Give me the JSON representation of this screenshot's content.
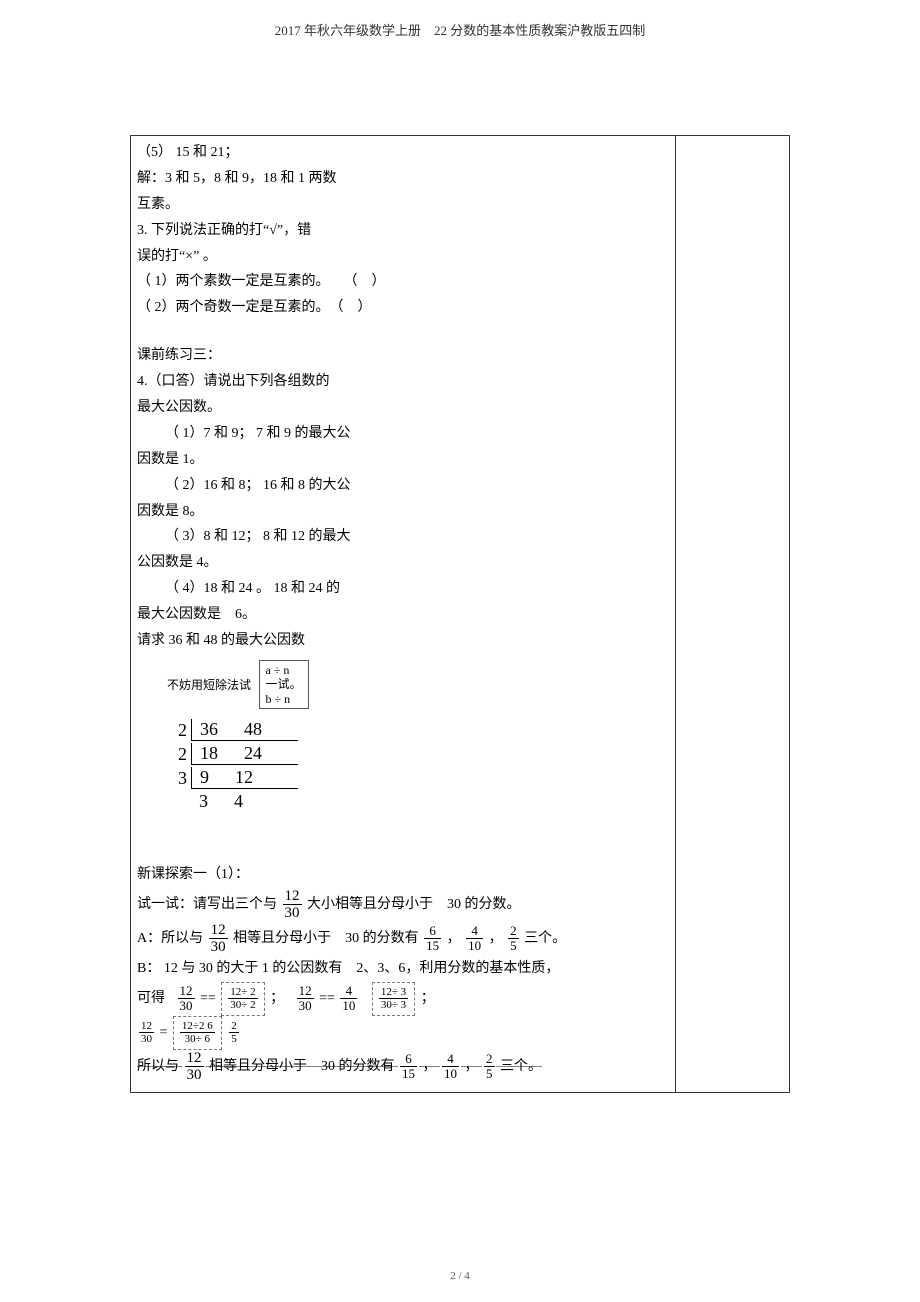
{
  "header": "2017 年秋六年级数学上册　22 分数的基本性质教案沪教版五四制",
  "footer": "2 / 4",
  "p5": "（5） 15 和 21；",
  "sol1": "解：3 和 5，8 和 9，18 和 1 两数",
  "sol2": "互素。",
  "q3a": "3. 下列说法正确的打“√”，错",
  "q3b": "误的打“×” 。",
  "q3_1": "（ 1）两个素数一定是互素的。　　（　）",
  "q3_2": "（ 2）两个奇数一定是互素的。　（　）",
  "pre3_title": "课前练习三：",
  "q4a": "4.（口答）请说出下列各组数的",
  "q4b": "最大公因数。",
  "q4_1a": "（ 1）7 和 9； 7 和 9 的最大公",
  "q4_1b": "因数是  1。",
  "q4_2a": "（ 2）16 和 8； 16 和 8 的大公",
  "q4_2b": "因数是  8。",
  "q4_3a": "（ 3）8 和 12； 8 和 12 的最大",
  "q4_3b": "公因数是  4。",
  "q4_4a": "（ 4）18 和 24 。 18 和 24 的",
  "q4_4b": "最大公因数是　6。",
  "q4_5": "请求 36 和 48 的最大公因数",
  "hint_label": "不妨用短除法试",
  "hint_top": "a ÷ n",
  "hint_mid": "一试。",
  "hint_bot": "b ÷ n",
  "sd": {
    "r1": {
      "d": "2",
      "a": "36",
      "b": "48"
    },
    "r2": {
      "d": "2",
      "a": "18",
      "b": "24"
    },
    "r3": {
      "d": "3",
      "a": "9",
      "b": "12"
    },
    "rf": {
      "a": "3",
      "b": "4"
    }
  },
  "explore_title": "新课探索一（1）：",
  "try_a": "试一试：请写出三个与",
  "try_frac_n": "12",
  "try_frac_d": "30",
  "try_b": "大小相等且分母小于　30 的分数。",
  "A_pre": "A：所以与",
  "A_main_n": "12",
  "A_main_d": "30",
  "A_mid1": "相等且分母小于　30",
  "A_mid2": "的分数有",
  "f1_n": "6",
  "f1_d": "15",
  "f2_n": "4",
  "f2_d": "10",
  "f3_n": "2",
  "f3_d": "5",
  "A_tail": "三个。",
  "B_line": "B： 12 与 30 的大于  1 的公因数有　2、3、6，利用分数的基本性质，",
  "lbl_12": "12",
  "lbl_30": "30",
  "lbl_15": "15",
  "lbl_10": "10",
  "lbl_5": "5",
  "lbl_4": "4",
  "lbl_eq": "==",
  "lbl_comma": "，",
  "lbl_semi": "；",
  "d12_2": "12÷ 2",
  "d30_2": "30÷ 2",
  "d12_3": "12÷ 3",
  "d30_3": "30÷ 3",
  "d12_6": "12÷2 6",
  "d30_6": "30÷ 6",
  "lbl_keda": "可得",
  "final_pre": "所以与",
  "final_mid1": "相等且分母小于　30",
  "final_mid2": "的分数有",
  "final_tail": "三个。"
}
